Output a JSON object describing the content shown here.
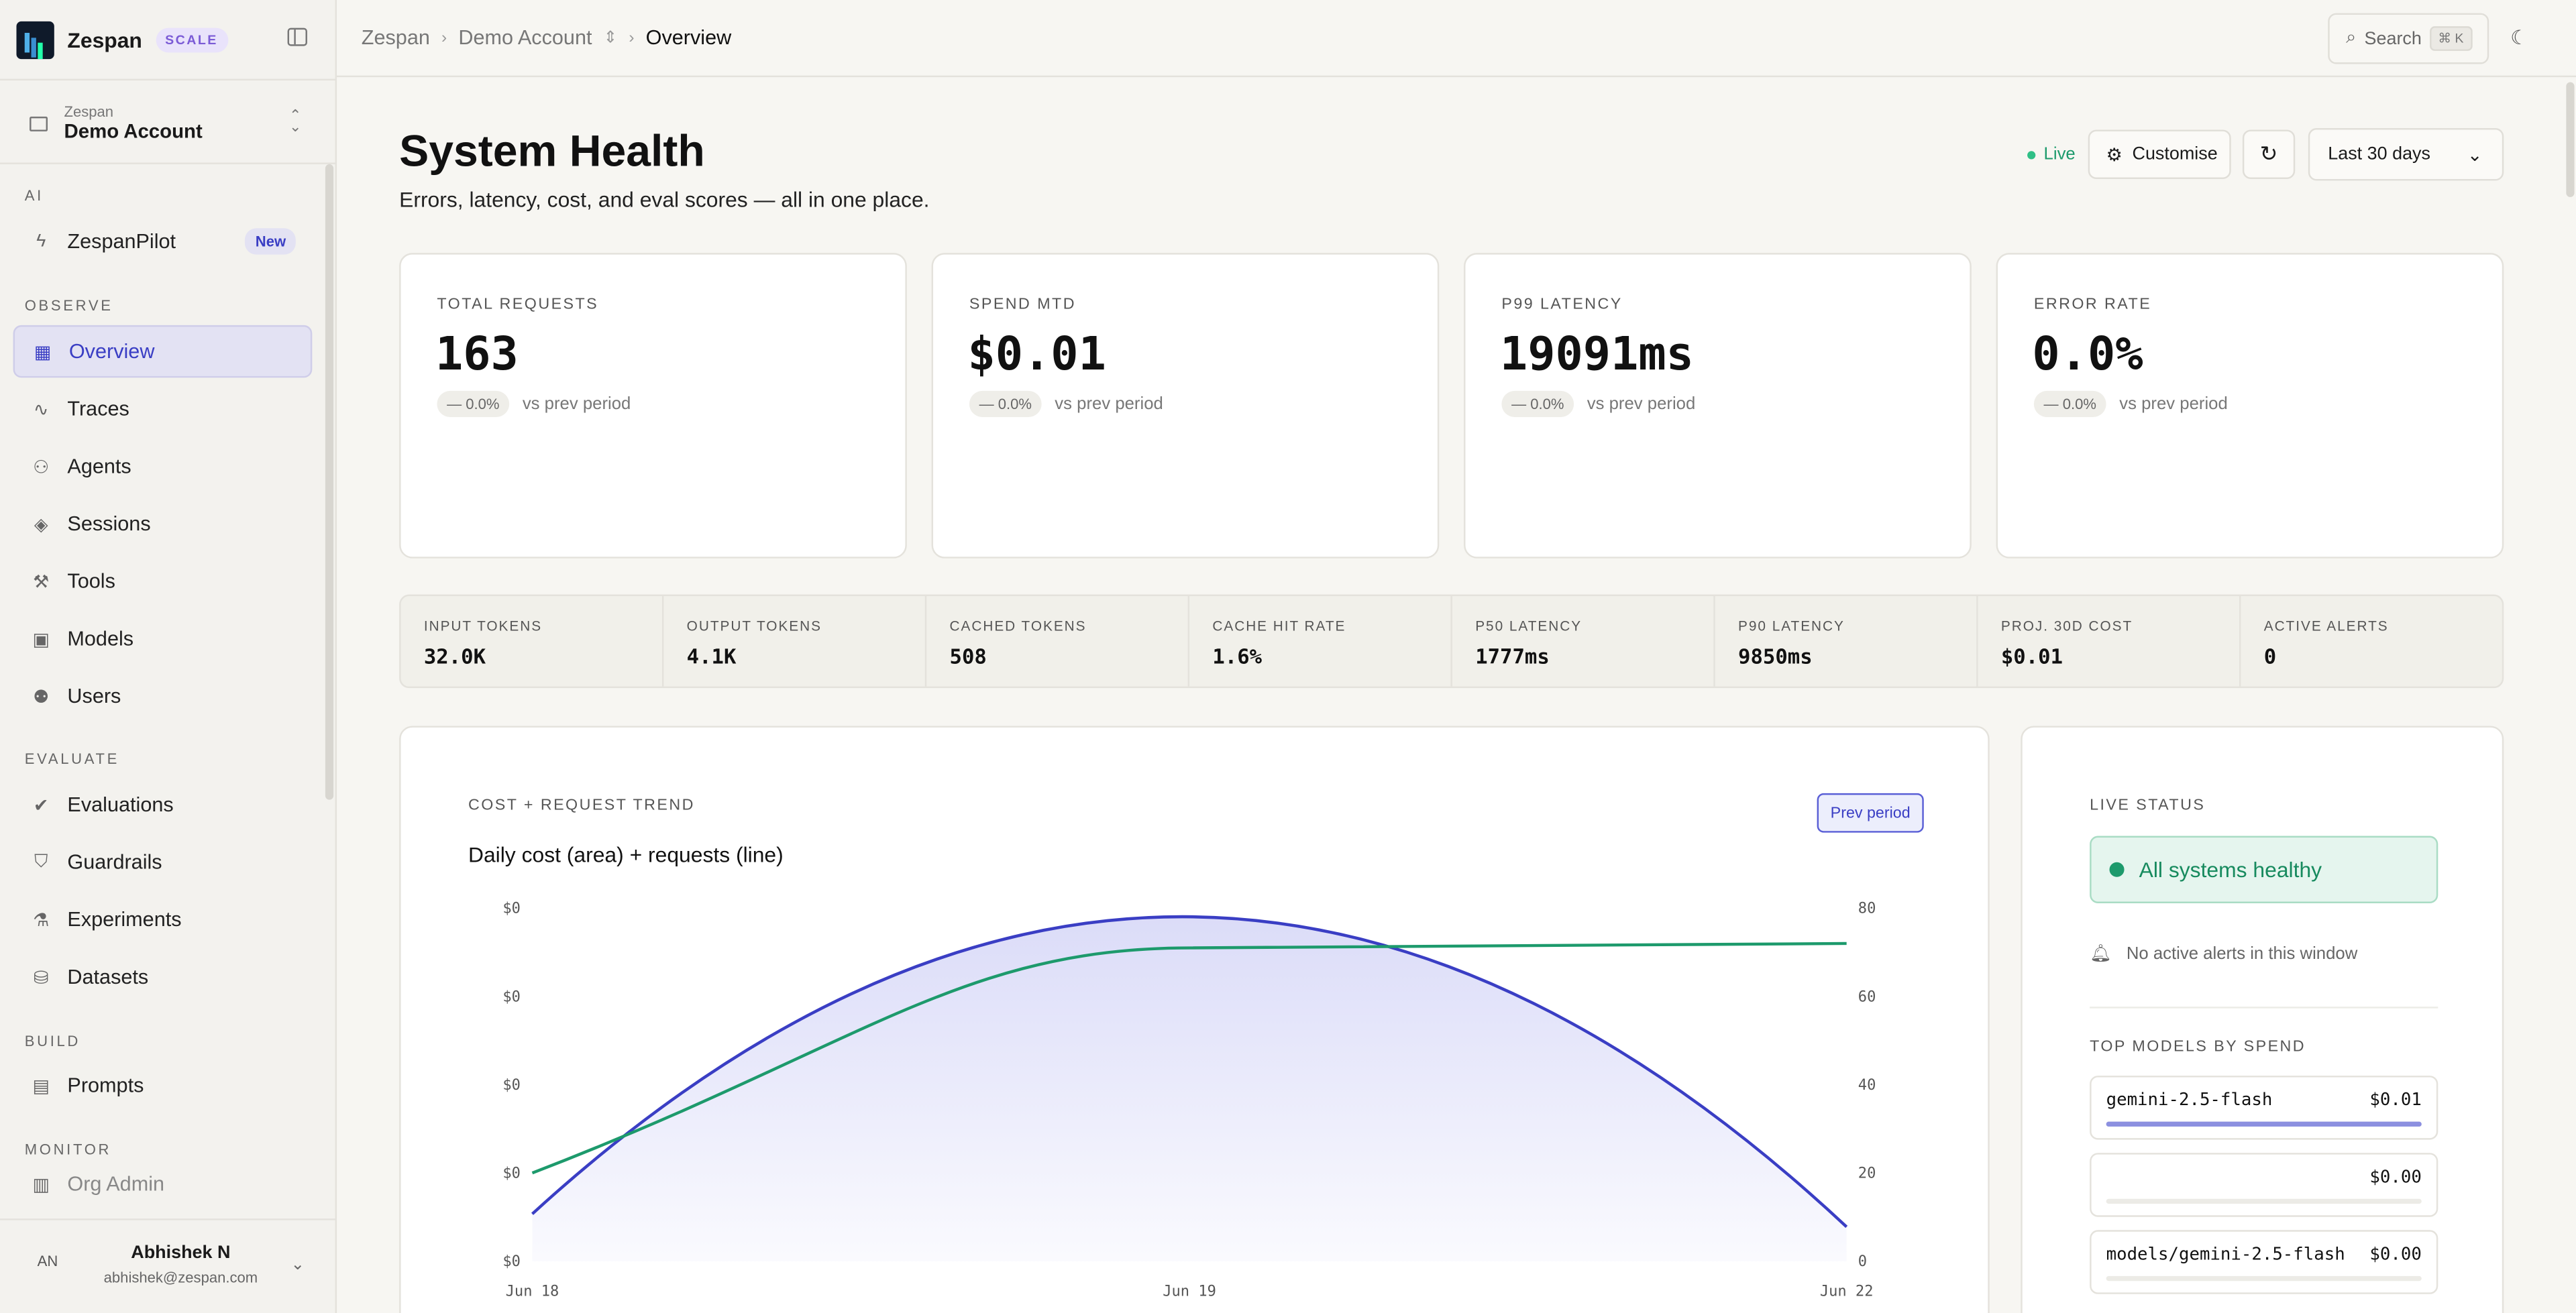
{
  "brand": {
    "name": "Zespan",
    "tier": "SCALE"
  },
  "account": {
    "org": "Zespan",
    "name": "Demo Account"
  },
  "sidebar": {
    "sections": [
      {
        "label": "AI"
      },
      {
        "label": "OBSERVE"
      },
      {
        "label": "EVALUATE"
      },
      {
        "label": "BUILD"
      },
      {
        "label": "MONITOR"
      }
    ],
    "pilot": {
      "label": "ZespanPilot",
      "badge": "New"
    },
    "observe": [
      "Overview",
      "Traces",
      "Agents",
      "Sessions",
      "Tools",
      "Models",
      "Users"
    ],
    "evaluate": [
      "Evaluations",
      "Guardrails",
      "Experiments",
      "Datasets"
    ],
    "build": [
      "Prompts"
    ],
    "monitor": [
      "Org Admin"
    ],
    "active": "Overview"
  },
  "user": {
    "initials": "AN",
    "name": "Abhishek N",
    "email": "abhishek@zespan.com"
  },
  "topbar": {
    "breadcrumbs": [
      "Zespan",
      "Demo Account",
      "Overview"
    ],
    "search_label": "Search",
    "search_kbd": "⌘ K"
  },
  "header": {
    "title": "System Health",
    "subtitle": "Errors, latency, cost, and eval scores — all in one place.",
    "live": "Live",
    "customise": "Customise",
    "range": "Last 30 days"
  },
  "kpis": [
    {
      "label": "TOTAL REQUESTS",
      "value": "163",
      "delta": "— 0.0%",
      "note": "vs prev period"
    },
    {
      "label": "SPEND MTD",
      "value": "$0.01",
      "delta": "— 0.0%",
      "note": "vs prev period"
    },
    {
      "label": "P99 LATENCY",
      "value": "19091ms",
      "delta": "— 0.0%",
      "note": "vs prev period"
    },
    {
      "label": "ERROR RATE",
      "value": "0.0%",
      "delta": "— 0.0%",
      "note": "vs prev period"
    }
  ],
  "metrics": [
    {
      "label": "INPUT TOKENS",
      "value": "32.0K"
    },
    {
      "label": "OUTPUT TOKENS",
      "value": "4.1K"
    },
    {
      "label": "CACHED TOKENS",
      "value": "508"
    },
    {
      "label": "CACHE HIT RATE",
      "value": "1.6%"
    },
    {
      "label": "P50 LATENCY",
      "value": "1777ms"
    },
    {
      "label": "P90 LATENCY",
      "value": "9850ms"
    },
    {
      "label": "PROJ. 30D COST",
      "value": "$0.01"
    },
    {
      "label": "ACTIVE ALERTS",
      "value": "0"
    }
  ],
  "trend": {
    "label": "COST + REQUEST TREND",
    "title": "Daily cost (area) + requests (line)",
    "prev_button": "Prev period"
  },
  "chart_data": {
    "type": "area",
    "x": [
      "Jun 18",
      "Jun 19",
      "Jun 22"
    ],
    "series": [
      {
        "kind": "area",
        "axis": "left",
        "color": "#3a3ec4",
        "values": [
          0.0011,
          0.008,
          0.0008
        ]
      },
      {
        "kind": "line",
        "axis": "right",
        "color": "#1d9a6c",
        "values": [
          20,
          71,
          72
        ]
      }
    ],
    "y_left_ticks": [
      "$0",
      "$0",
      "$0",
      "$0",
      "$0"
    ],
    "y_right_ticks": [
      "80",
      "60",
      "40",
      "20",
      "0"
    ],
    "y_right_range": [
      0,
      80
    ],
    "grid": false
  },
  "status": {
    "label": "LIVE STATUS",
    "healthy": "All systems healthy",
    "alerts": "No active alerts in this window",
    "top_label": "TOP MODELS BY SPEND",
    "models": [
      {
        "name": "gemini-2.5-flash",
        "cost": "$0.01",
        "share": 1.0
      },
      {
        "name": "",
        "cost": "$0.00",
        "share": 0.0
      },
      {
        "name": "models/gemini-2.5-flash",
        "cost": "$0.00",
        "share": 0.0
      }
    ]
  }
}
